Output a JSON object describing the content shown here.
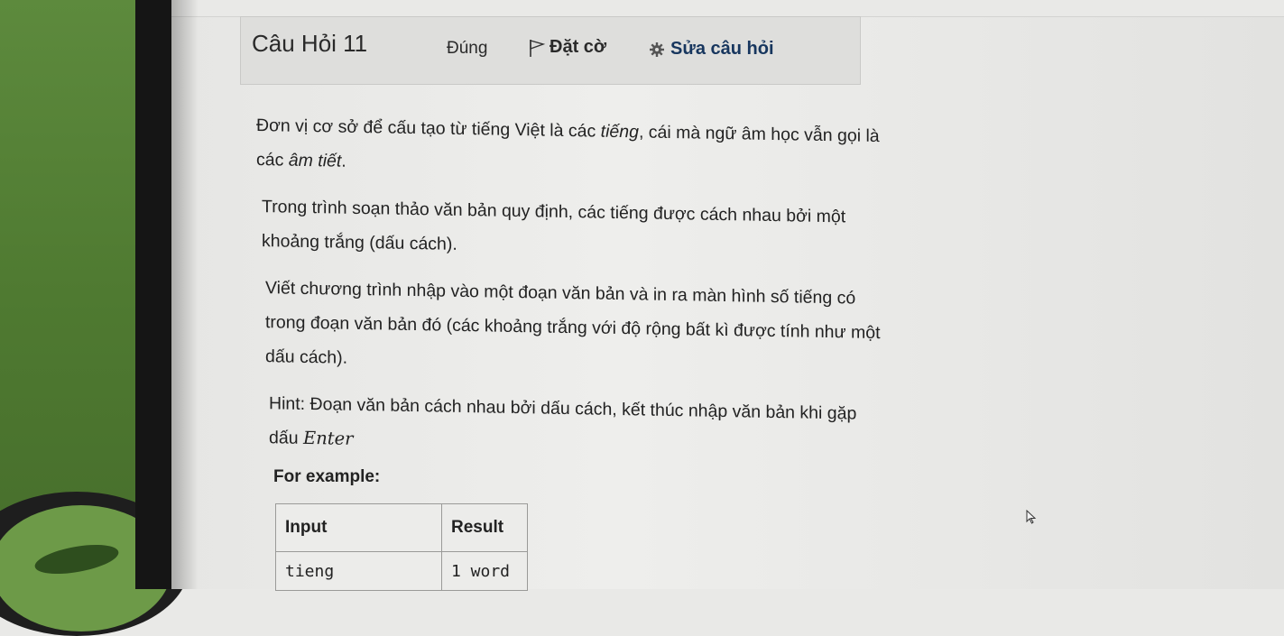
{
  "question": {
    "title": "Câu Hỏi 11",
    "status": "Đúng",
    "flag_label": "Đặt cờ",
    "edit_label": "Sửa câu hỏi"
  },
  "content": {
    "p1_a": "Đơn vị cơ sở để cấu tạo từ tiếng Việt là các ",
    "p1_em1": "tiếng",
    "p1_b": ", cái mà ngữ âm học vẫn gọi là các ",
    "p1_em2": "âm tiết",
    "p1_c": ".",
    "p2": "Trong trình soạn thảo văn bản quy định, các tiếng được cách nhau bởi một khoảng trắng (dấu cách).",
    "p3": "Viết chương trình nhập vào một đoạn văn bản và in ra màn hình số tiếng có trong đoạn văn bản đó (các khoảng trắng với độ rộng bất kì được tính như một dấu cách).",
    "hint_text": "Hint: Đoạn văn bản cách nhau bởi dấu cách, kết thúc nhập văn bản khi gặp dấu ",
    "hint_math": "Enter"
  },
  "examples": {
    "label": "For example:",
    "headers": [
      "Input",
      "Result"
    ],
    "rows": [
      [
        "tieng",
        "1 word"
      ]
    ]
  },
  "colors": {
    "edit_link": "#17365e",
    "header_bg": "#dededc"
  }
}
